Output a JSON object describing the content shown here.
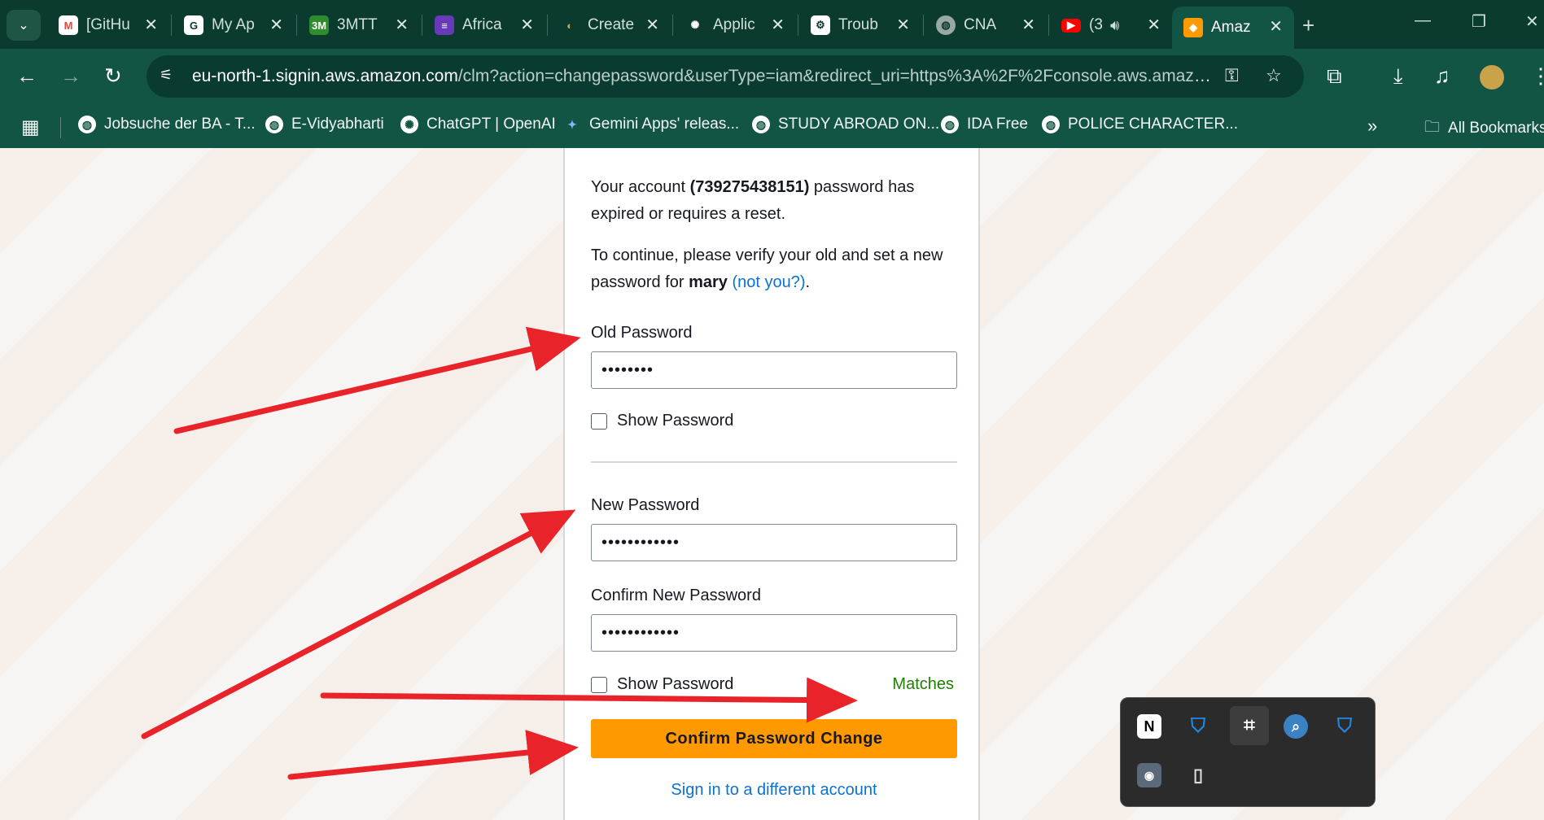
{
  "tabs": [
    {
      "title": "[GitHu",
      "favicon": "gmail-icon",
      "color": "#e8453c"
    },
    {
      "title": "My Ap",
      "favicon": "app-icon",
      "color": "#ffffff"
    },
    {
      "title": "3MTT",
      "favicon": "3mtt-icon",
      "color": "#2e8b2e"
    },
    {
      "title": "Africa",
      "favicon": "forms-icon",
      "color": "#673ab7"
    },
    {
      "title": "Create",
      "favicon": "create-icon",
      "color": "#e0a33a"
    },
    {
      "title": "Applic",
      "favicon": "openai-icon",
      "color": "#ffffff"
    },
    {
      "title": "Troub",
      "favicon": "trouble-icon",
      "color": "#ffffff"
    },
    {
      "title": "CNA",
      "favicon": "globe-icon",
      "color": "#9aa8a4"
    },
    {
      "title": "(3",
      "favicon": "youtube-icon",
      "color": "#ff0000"
    },
    {
      "title": "Amaz",
      "favicon": "aws-icon",
      "color": "#ff9900"
    }
  ],
  "url": {
    "domain": "eu-north-1.signin.aws.amazon.com",
    "path": "/clm?action=changepassword&userType=iam&redirect_uri=https%3A%2F%2Fconsole.aws.amazon..."
  },
  "bookmarks": [
    "Jobsuche der BA - T...",
    "E-Vidyabharti",
    "ChatGPT | OpenAI",
    "Gemini Apps' releas...",
    "STUDY ABROAD ON...",
    "IDA Free",
    "POLICE CHARACTER..."
  ],
  "bookmarks_more": "»",
  "all_bookmarks": "All Bookmarks",
  "form": {
    "intro_pre": "Your account ",
    "account_id": "(739275438151)",
    "intro_post": " password has expired or requires a reset.",
    "verify_pre": "To continue, please verify your old and set a new password for ",
    "username": "mary",
    "not_you": "(not you?)",
    "verify_post": ".",
    "old_password_label": "Old Password",
    "old_password_value": "••••••••",
    "show_password_label": "Show Password",
    "new_password_label": "New Password",
    "new_password_value": "••••••••••••",
    "confirm_password_label": "Confirm New Password",
    "confirm_password_value": "••••••••••••",
    "show_password_label_2": "Show Password",
    "match_status": "Matches",
    "submit_label": "Confirm Password Change",
    "different_account_link": "Sign in to a different account"
  },
  "colors": {
    "accent": "#ff9900",
    "link": "#0972d3",
    "success": "#1d8102",
    "annotation_arrow": "#e8232a",
    "browser_frame": "#125545"
  }
}
